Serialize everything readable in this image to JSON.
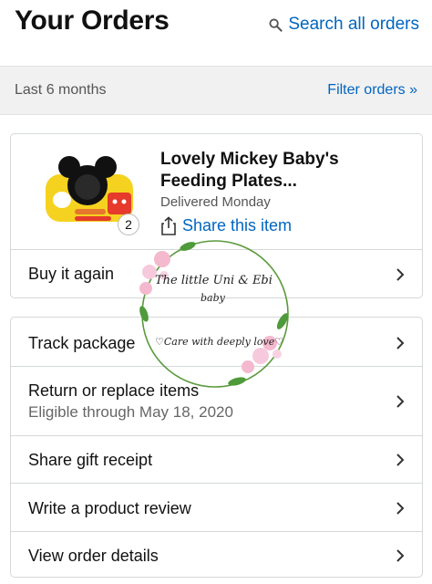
{
  "header": {
    "title": "Your Orders",
    "search_label": "Search all orders",
    "search_icon": "search-icon"
  },
  "filter": {
    "period": "Last 6 months",
    "link": "Filter orders »"
  },
  "order": {
    "product_title": "Lovely Mickey Baby's Feeding Plates...",
    "status": "Delivered Monday",
    "quantity": "2",
    "share_label": "Share this item",
    "buy_again_label": "Buy it again"
  },
  "actions": [
    {
      "label": "Track package",
      "sub": ""
    },
    {
      "label": "Return or replace items",
      "sub": "Eligible through May 18, 2020"
    },
    {
      "label": "Share gift receipt",
      "sub": ""
    },
    {
      "label": "Write a product review",
      "sub": ""
    },
    {
      "label": "View order details",
      "sub": ""
    }
  ],
  "watermark": {
    "line1": "The little Uni & Ebi",
    "line2": "baby",
    "line3": "♡Care with deeply love♡"
  },
  "colors": {
    "link": "#0066c0",
    "filter_bg": "#f1f1f1",
    "border": "#d5d9d9",
    "muted_text": "#555555"
  }
}
